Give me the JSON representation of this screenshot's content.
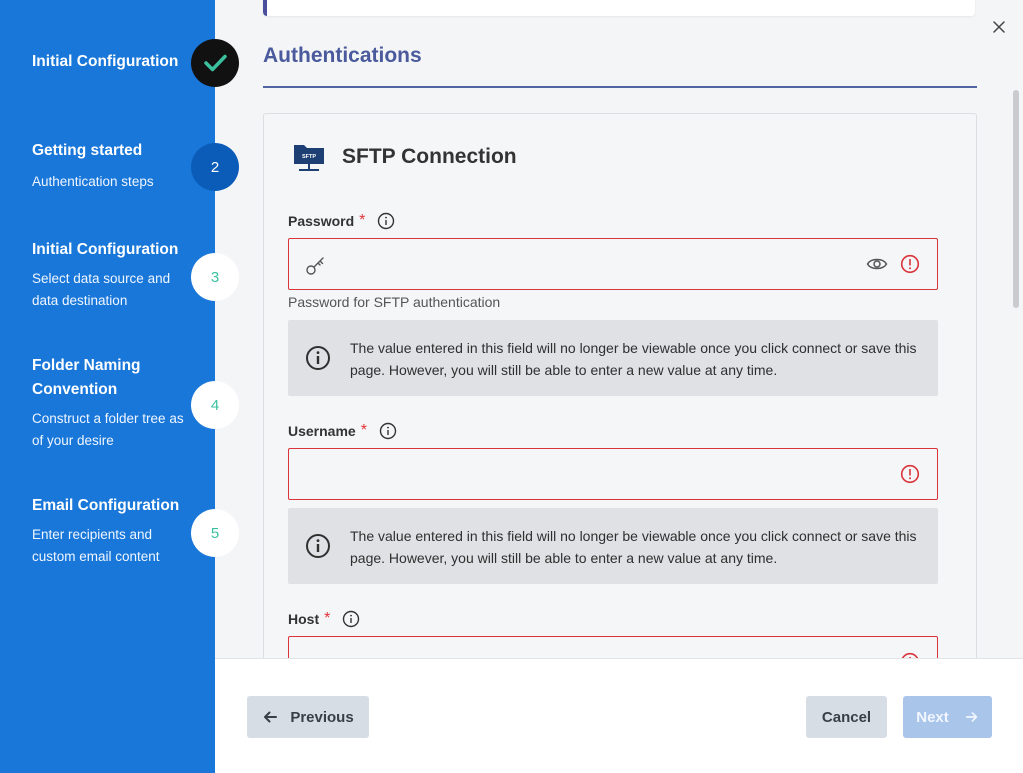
{
  "wizard": {
    "steps": [
      {
        "number": "",
        "title": "Initial Configuration",
        "subtitle": "",
        "state": "done"
      },
      {
        "number": "2",
        "title": "Getting started",
        "subtitle": "Authentication steps",
        "state": "active"
      },
      {
        "number": "3",
        "title": "Initial Configuration",
        "subtitle": "Select data source and data destination",
        "state": "todo"
      },
      {
        "number": "4",
        "title": "Folder Naming Convention",
        "subtitle": "Construct a folder tree as of your desire",
        "state": "todo"
      },
      {
        "number": "5",
        "title": "Email Configuration",
        "subtitle": "Enter recipients and custom email content",
        "state": "todo"
      }
    ]
  },
  "main": {
    "section_title": "Authentications",
    "panel": {
      "icon_label": "SFTP",
      "title": "SFTP Connection",
      "fields": {
        "password": {
          "label": "Password",
          "required_mark": "*",
          "value": "",
          "placeholder": "",
          "helper": "Password for SFTP authentication",
          "notice": "The value entered in this field will no longer be viewable once you click connect or save this page. However, you will still be able to enter a new value at any time."
        },
        "username": {
          "label": "Username",
          "required_mark": "*",
          "value": "",
          "placeholder": "",
          "notice": "The value entered in this field will no longer be viewable once you click connect or save this page. However, you will still be able to enter a new value at any time."
        },
        "host": {
          "label": "Host",
          "required_mark": "*",
          "value": "",
          "placeholder": ""
        }
      }
    }
  },
  "footer": {
    "previous_label": "Previous",
    "cancel_label": "Cancel",
    "next_label": "Next"
  },
  "colors": {
    "sidebar": "#1877d9",
    "accent": "#4a5a9c",
    "error": "#d9343a",
    "done_check": "#3cc1a0"
  },
  "icons": [
    "check-icon",
    "close-icon",
    "sftp-folder-icon",
    "info-icon",
    "key-icon",
    "eye-icon",
    "error-icon",
    "arrow-left-icon",
    "arrow-right-icon"
  ]
}
